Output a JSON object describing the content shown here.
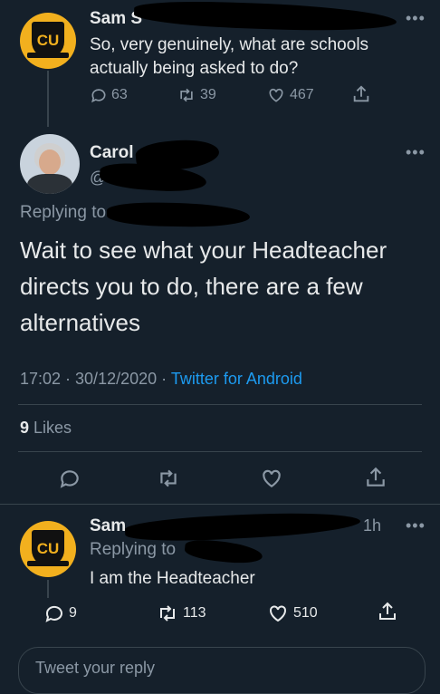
{
  "tweet1": {
    "author_name": "Sam S",
    "text_line1": "So, very genuinely, what are schools",
    "text_line2": "actually being asked to do?",
    "replies": "63",
    "retweets": "39",
    "likes": "467"
  },
  "main_tweet": {
    "author_name": "Carol",
    "handle": "@",
    "replying_to_label": "Replying to",
    "text_line1": "Wait to see what your Headteacher",
    "text_line2": "directs you to do,  there are a few",
    "text_line3": "alternatives",
    "time": "17:02 · 30/12/2020 ·",
    "source": "Twitter for Android",
    "likes_count": "9",
    "likes_label": "Likes"
  },
  "reply": {
    "author_name": "Sam",
    "time_ago": "1h",
    "replying_to_label": "Replying to",
    "text": "I am the Headteacher",
    "replies": "9",
    "retweets": "113",
    "likes": "510"
  },
  "composer": {
    "placeholder": "Tweet your reply"
  },
  "colors": {
    "background": "#15202b",
    "accent": "#1d9bf0",
    "muted": "#8b98a5"
  }
}
